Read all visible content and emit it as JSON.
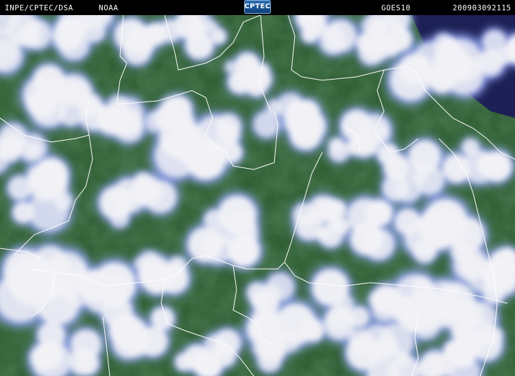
{
  "header": {
    "source_label": "INPE/CPTEC/DSA",
    "agency_label": "NOAA",
    "logo_text": "CPTEC",
    "satellite_label": "GOES10",
    "timestamp": "200903092115"
  },
  "image": {
    "kind": "satellite-composite",
    "ground_color": "#2b5a2f",
    "cloud_color": "#f2f2f6",
    "cloud_edge_color": "#8fa0ef",
    "ocean_color": "#1c2055",
    "border_color": "#ffffff"
  }
}
